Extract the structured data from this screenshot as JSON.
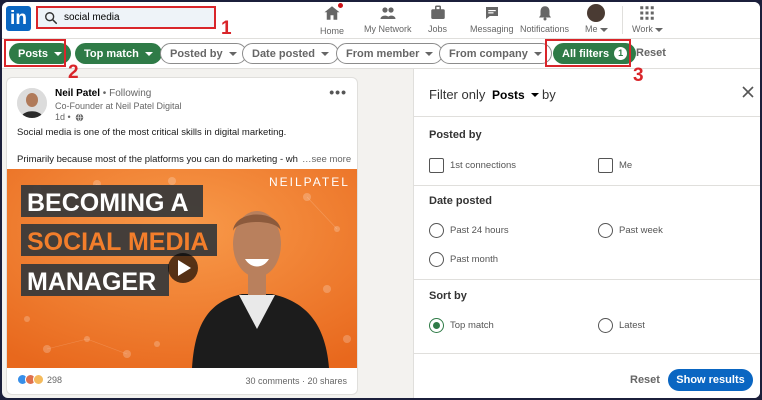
{
  "search": {
    "value": "social media",
    "placeholder": "Search"
  },
  "nav": {
    "home": "Home",
    "network": "My Network",
    "jobs": "Jobs",
    "messaging": "Messaging",
    "notifications": "Notifications",
    "me": "Me",
    "work": "Work"
  },
  "filters": {
    "posts": "Posts",
    "top_match": "Top match",
    "posted_by": "Posted by",
    "date_posted": "Date posted",
    "from_member": "From member",
    "from_company": "From company",
    "all_filters": "All filters",
    "all_filters_count": "1",
    "reset": "Reset"
  },
  "annotations": {
    "one": "1",
    "two": "2",
    "three": "3"
  },
  "post": {
    "author": "Neil Patel",
    "following": " • Following",
    "headline": "Co-Founder at Neil Patel Digital",
    "time": "1d •",
    "text1": "Social media is one of the most critical skills in digital marketing.",
    "text2": "Primarily because most of the platforms you can do marketing - wh",
    "see_more": "…see more",
    "image": {
      "brand": "NEILPATEL",
      "line1": "BECOMING A",
      "line2": "SOCIAL MEDIA",
      "line3": "MANAGER"
    },
    "reaction_count": "298",
    "stats": "30 comments · 20 shares"
  },
  "panel": {
    "filter_only": "Filter only",
    "type": "Posts",
    "by": "by",
    "posted_by": {
      "title": "Posted by",
      "options": [
        "1st connections",
        "Me"
      ]
    },
    "date_posted": {
      "title": "Date posted",
      "options": [
        "Past 24 hours",
        "Past week",
        "Past month"
      ]
    },
    "sort_by": {
      "title": "Sort by",
      "options": [
        "Top match",
        "Latest"
      ],
      "selected": "Top match"
    },
    "reset": "Reset",
    "show_results": "Show results"
  },
  "colors": {
    "linkedin_blue": "#0a66c2",
    "filter_green": "#2f7b47",
    "annotation_red": "#d9252a",
    "image_orange": "#f37e2b"
  }
}
